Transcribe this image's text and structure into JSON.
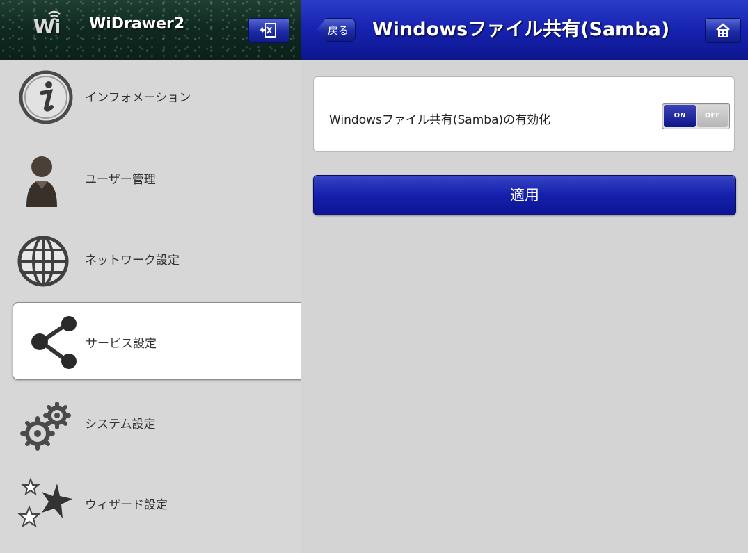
{
  "app": {
    "title": "WiDrawer2",
    "logo_text": "Wi"
  },
  "sidebar": {
    "items": [
      {
        "label": "インフォメーション",
        "icon": "info-icon"
      },
      {
        "label": "ユーザー管理",
        "icon": "user-icon"
      },
      {
        "label": "ネットワーク設定",
        "icon": "globe-icon"
      },
      {
        "label": "サービス設定",
        "icon": "share-icon",
        "active": true
      },
      {
        "label": "システム設定",
        "icon": "gears-icon"
      },
      {
        "label": "ウィザード設定",
        "icon": "stars-icon"
      }
    ]
  },
  "header": {
    "back_label": "戻る",
    "title": "Windowsファイル共有(Samba)"
  },
  "settings": {
    "samba_label": "Windowsファイル共有(Samba)の有効化",
    "toggle_on": "ON",
    "toggle_off": "OFF",
    "enabled": true
  },
  "actions": {
    "apply_label": "適用"
  },
  "colors": {
    "accent": "#1420ac",
    "sidebar_bg": "#d7d7d7",
    "content_bg": "#d4d4d4"
  }
}
